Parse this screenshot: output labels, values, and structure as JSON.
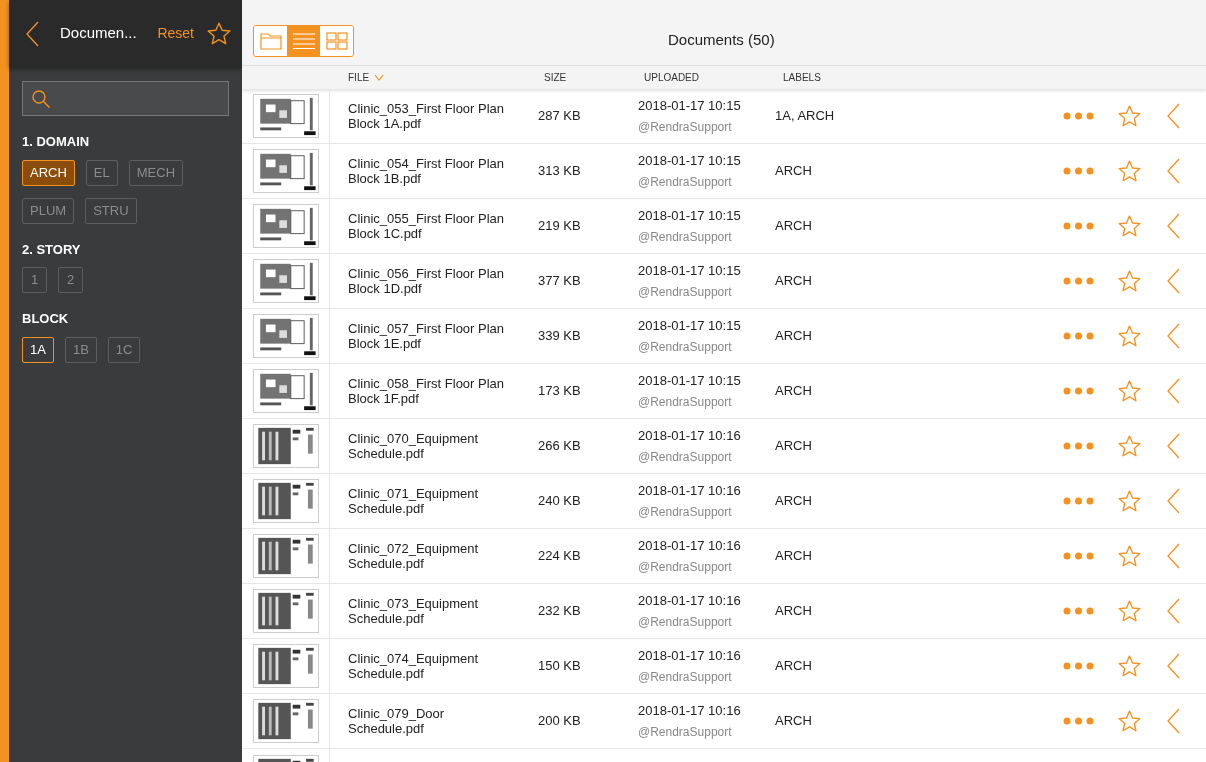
{
  "sidebar": {
    "title": "Documen...",
    "reset": "Reset",
    "filter_groups": [
      {
        "title": "1. DOMAIN",
        "options": [
          {
            "label": "ARCH",
            "selected": true
          },
          {
            "label": "EL",
            "selected": false
          },
          {
            "label": "MECH",
            "selected": false
          },
          {
            "label": "PLUM",
            "selected": false
          },
          {
            "label": "STRU",
            "selected": false
          }
        ]
      },
      {
        "title": "2. STORY",
        "options": [
          {
            "label": "1",
            "selected": false
          },
          {
            "label": "2",
            "selected": false
          }
        ]
      },
      {
        "title": "BLOCK",
        "options": [
          {
            "label": "1A",
            "selected": true
          },
          {
            "label": "1B",
            "selected": false
          },
          {
            "label": "1C",
            "selected": false
          }
        ]
      }
    ]
  },
  "toolbar": {
    "views": [
      {
        "kind": "folder",
        "selected": false
      },
      {
        "kind": "list",
        "selected": true
      },
      {
        "kind": "grid",
        "selected": false
      }
    ],
    "title": "Documents (50)"
  },
  "table": {
    "columns": [
      {
        "label": "FILE",
        "sorted": true
      },
      {
        "label": "SIZE",
        "sorted": false
      },
      {
        "label": "UPLOADED",
        "sorted": false
      },
      {
        "label": "LABELS",
        "sorted": false
      }
    ],
    "rows": [
      {
        "file": "Clinic_053_First Floor Plan Block 1A.pdf",
        "size": "287 KB",
        "uploaded": "2018-01-17 10:15",
        "user": "@RendraSupport",
        "labels": "1A, ARCH"
      },
      {
        "file": "Clinic_054_First Floor Plan Block 1B.pdf",
        "size": "313 KB",
        "uploaded": "2018-01-17 10:15",
        "user": "@RendraSupport",
        "labels": "ARCH"
      },
      {
        "file": "Clinic_055_First Floor Plan Block 1C.pdf",
        "size": "219 KB",
        "uploaded": "2018-01-17 10:15",
        "user": "@RendraSupport",
        "labels": "ARCH"
      },
      {
        "file": "Clinic_056_First Floor Plan Block 1D.pdf",
        "size": "377 KB",
        "uploaded": "2018-01-17 10:15",
        "user": "@RendraSupport",
        "labels": "ARCH"
      },
      {
        "file": "Clinic_057_First Floor Plan Block 1E.pdf",
        "size": "339 KB",
        "uploaded": "2018-01-17 10:15",
        "user": "@RendraSupport",
        "labels": "ARCH"
      },
      {
        "file": "Clinic_058_First Floor Plan Block 1F.pdf",
        "size": "173 KB",
        "uploaded": "2018-01-17 10:15",
        "user": "@RendraSupport",
        "labels": "ARCH"
      },
      {
        "file": "Clinic_070_Equipment Schedule.pdf",
        "size": "266 KB",
        "uploaded": "2018-01-17 10:16",
        "user": "@RendraSupport",
        "labels": "ARCH"
      },
      {
        "file": "Clinic_071_Equipment Schedule.pdf",
        "size": "240 KB",
        "uploaded": "2018-01-17 10:16",
        "user": "@RendraSupport",
        "labels": "ARCH"
      },
      {
        "file": "Clinic_072_Equipment Schedule.pdf",
        "size": "224 KB",
        "uploaded": "2018-01-17 10:16",
        "user": "@RendraSupport",
        "labels": "ARCH"
      },
      {
        "file": "Clinic_073_Equipment Schedule.pdf",
        "size": "232 KB",
        "uploaded": "2018-01-17 10:16",
        "user": "@RendraSupport",
        "labels": "ARCH"
      },
      {
        "file": "Clinic_074_Equipment Schedule.pdf",
        "size": "150 KB",
        "uploaded": "2018-01-17 10:16",
        "user": "@RendraSupport",
        "labels": "ARCH"
      },
      {
        "file": "Clinic_079_Door Schedule.pdf",
        "size": "200 KB",
        "uploaded": "2018-01-17 10:16",
        "user": "@RendraSupport",
        "labels": "ARCH"
      }
    ]
  }
}
